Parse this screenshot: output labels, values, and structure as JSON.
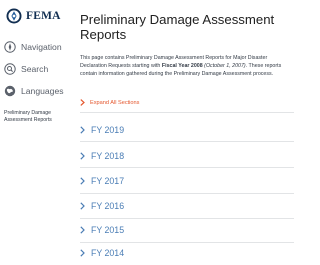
{
  "brand": {
    "name": "FEMA",
    "accent": "#112e51"
  },
  "sidebar": {
    "items": [
      {
        "label": "Navigation",
        "icon": "navigation-icon"
      },
      {
        "label": "Search",
        "icon": "search-icon"
      },
      {
        "label": "Languages",
        "icon": "languages-icon"
      }
    ],
    "page_link": "Preliminary Damage Assessment Reports"
  },
  "main": {
    "title": "Preliminary Damage Assessment Reports",
    "intro": {
      "part1": "This page contains Preliminary Damage Assessment Reports for Major Disaster Declaration Requests starting with ",
      "bold": "Fiscal Year 2008",
      "italic": " (October 1, 2007)",
      "part2": ".  These reports contain information gathered during the Preliminary Damage Assessment process."
    },
    "expand_label": "Expand All Sections",
    "sections": [
      {
        "label": "FY 2019"
      },
      {
        "label": "FY 2018"
      },
      {
        "label": "FY 2017"
      },
      {
        "label": "FY 2016"
      },
      {
        "label": "FY 2015"
      },
      {
        "label": "FY 2014"
      }
    ]
  },
  "colors": {
    "link": "#4a7db5",
    "expand": "#e4572e",
    "chevron": "#e4572e",
    "divider": "#e2e4e6"
  }
}
